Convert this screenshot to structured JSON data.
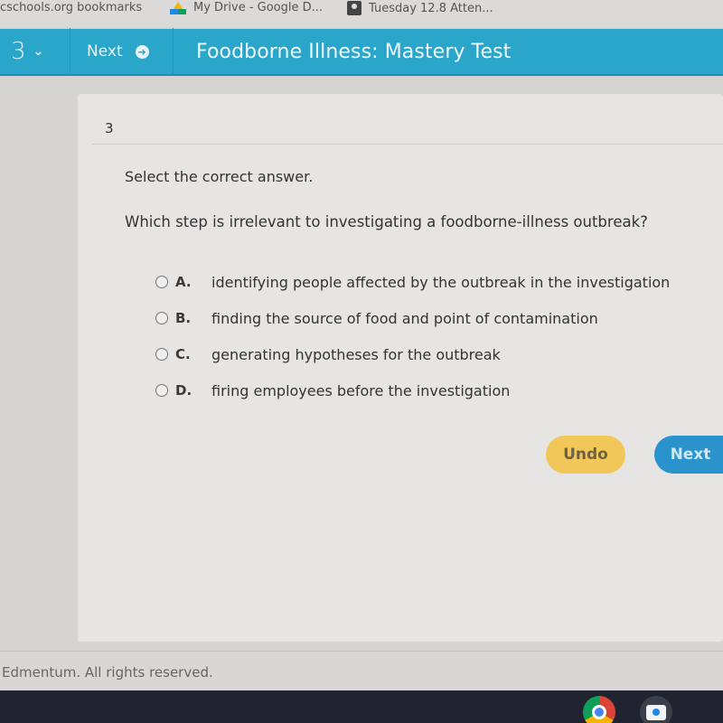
{
  "browser": {
    "bookmarks": [
      {
        "label": "cschools.org bookmarks",
        "icon": "none"
      },
      {
        "label": "My Drive - Google D...",
        "icon": "google-drive-icon"
      },
      {
        "label": "Tuesday 12.8 Atten...",
        "icon": "contact-icon"
      }
    ]
  },
  "nav": {
    "question_number": "3",
    "question_dropdown_icon": "chevron-down-icon",
    "next_label": "Next",
    "next_icon": "arrow-right-circle-icon",
    "title": "Foodborne Illness: Mastery Test"
  },
  "question": {
    "number": "3",
    "instruction": "Select the correct answer.",
    "prompt": "Which step is irrelevant to investigating a foodborne-illness outbreak?",
    "options": [
      {
        "letter": "A.",
        "text": "identifying people affected by the outbreak in the investigation",
        "selected": false
      },
      {
        "letter": "B.",
        "text": "finding the source of food and point of contamination",
        "selected": false
      },
      {
        "letter": "C.",
        "text": "generating hypotheses for the outbreak",
        "selected": false
      },
      {
        "letter": "D.",
        "text": "firing employees before the investigation",
        "selected": false
      }
    ]
  },
  "actions": {
    "undo_label": "Undo",
    "next_label": "Next",
    "undo_color": "#f2c75a",
    "next_color": "#2b93cc"
  },
  "footer": {
    "copyright": "Edmentum. All rights reserved."
  },
  "taskbar": {
    "apps": [
      "chrome-icon",
      "camera-icon"
    ]
  },
  "colors": {
    "nav_bar": "#2ba6cb"
  }
}
